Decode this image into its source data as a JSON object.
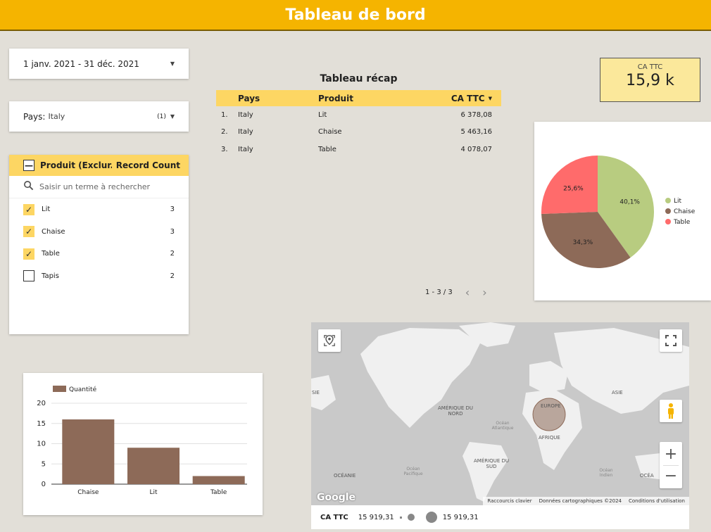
{
  "header": {
    "title": "Tableau de bord"
  },
  "date_control": {
    "value": "1 janv. 2021 - 31 déc. 2021"
  },
  "country_control": {
    "label": "Pays:",
    "value": "Italy",
    "count": "(1)"
  },
  "product_filter": {
    "col1": "Produit (Exclur...",
    "col2": "Record Count",
    "search_placeholder": "Saisir un terme à rechercher",
    "items": [
      {
        "label": "Lit",
        "count": "3",
        "checked": true
      },
      {
        "label": "Chaise",
        "count": "3",
        "checked": true
      },
      {
        "label": "Table",
        "count": "2",
        "checked": true
      },
      {
        "label": "Tapis",
        "count": "2",
        "checked": false
      }
    ]
  },
  "recap_table": {
    "title": "Tableau récap",
    "headers": [
      "Pays",
      "Produit",
      "CA TTC"
    ],
    "rows": [
      {
        "n": "1.",
        "pays": "Italy",
        "produit": "Lit",
        "ca": "6 378,08"
      },
      {
        "n": "2.",
        "pays": "Italy",
        "produit": "Chaise",
        "ca": "5 463,16"
      },
      {
        "n": "3.",
        "pays": "Italy",
        "produit": "Table",
        "ca": "4 078,07"
      }
    ],
    "pagination": "1 - 3 / 3"
  },
  "kpi": {
    "label": "CA TTC",
    "value": "15,9 k"
  },
  "map": {
    "labels": {
      "asia_left": "SIE",
      "asia": "ASIE",
      "north_america": "AMÉRIQUE DU NORD",
      "europe": "EUROPE",
      "africa": "AFRIQUE",
      "south_america": "AMÉRIQUE DU SUD",
      "oceania_left": "OCÉANIE",
      "oceania_right": "OCÉA",
      "atlantic": "Océan Atlantique",
      "pacific": "Océan Pacifique",
      "indian": "Océan Indien"
    },
    "attribution": [
      "Raccourcis clavier",
      "Données cartographiques ©2024",
      "Conditions d'utilisation"
    ],
    "google": "Google",
    "legend": {
      "metric": "CA TTC",
      "min": "15 919,31",
      "max": "15 919,31"
    }
  },
  "chart_data": [
    {
      "type": "pie",
      "labels": [
        "Lit",
        "Chaise",
        "Table"
      ],
      "values": [
        40.1,
        34.3,
        25.6
      ],
      "value_labels": [
        "40,1%",
        "34,3%",
        "25,6%"
      ],
      "colors": [
        "#b8cc80",
        "#8d6a58",
        "#ff6b6b"
      ],
      "legend": "right"
    },
    {
      "type": "bar",
      "categories": [
        "Chaise",
        "Lit",
        "Table"
      ],
      "series": [
        {
          "name": "Quantité",
          "values": [
            16,
            9,
            2
          ]
        }
      ],
      "ylim": [
        0,
        20
      ],
      "yticks": [
        "0",
        "5",
        "10",
        "15",
        "20"
      ],
      "color": "#8d6a58",
      "legend": "top-left"
    }
  ]
}
